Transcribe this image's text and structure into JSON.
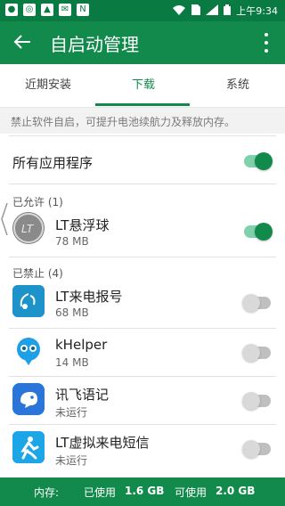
{
  "status_bar": {
    "time": "上午9:34"
  },
  "header": {
    "title": "自启动管理"
  },
  "tabs": [
    {
      "label": "近期安装",
      "selected": false
    },
    {
      "label": "下载",
      "selected": true
    },
    {
      "label": "系统",
      "selected": false
    }
  ],
  "hint": "禁止软件自启，可提升电池续航力及释放内存。",
  "all_apps": {
    "label": "所有应用程序",
    "toggle_on": true
  },
  "allowed": {
    "header": "已允许 (1)",
    "items": [
      {
        "name": "LT悬浮球",
        "sub": "78 MB",
        "toggle_on": true
      }
    ]
  },
  "blocked": {
    "header": "已禁止 (4)",
    "items": [
      {
        "name": "LT来电报号",
        "sub": "68 MB",
        "toggle_on": false
      },
      {
        "name": "kHelper",
        "sub": "14 MB",
        "toggle_on": false
      },
      {
        "name": "讯飞语记",
        "sub": "未运行",
        "toggle_on": false
      },
      {
        "name": "LT虚拟来电短信",
        "sub": "未运行",
        "toggle_on": false
      }
    ]
  },
  "bottom_bar": {
    "memory_label": "内存:",
    "used_label": "已使用",
    "used_value": "1.6 GB",
    "available_label": "可使用",
    "available_value": "2.0 GB"
  },
  "colors": {
    "primary": "#128a4b",
    "status_bar": "#0a7a43"
  }
}
